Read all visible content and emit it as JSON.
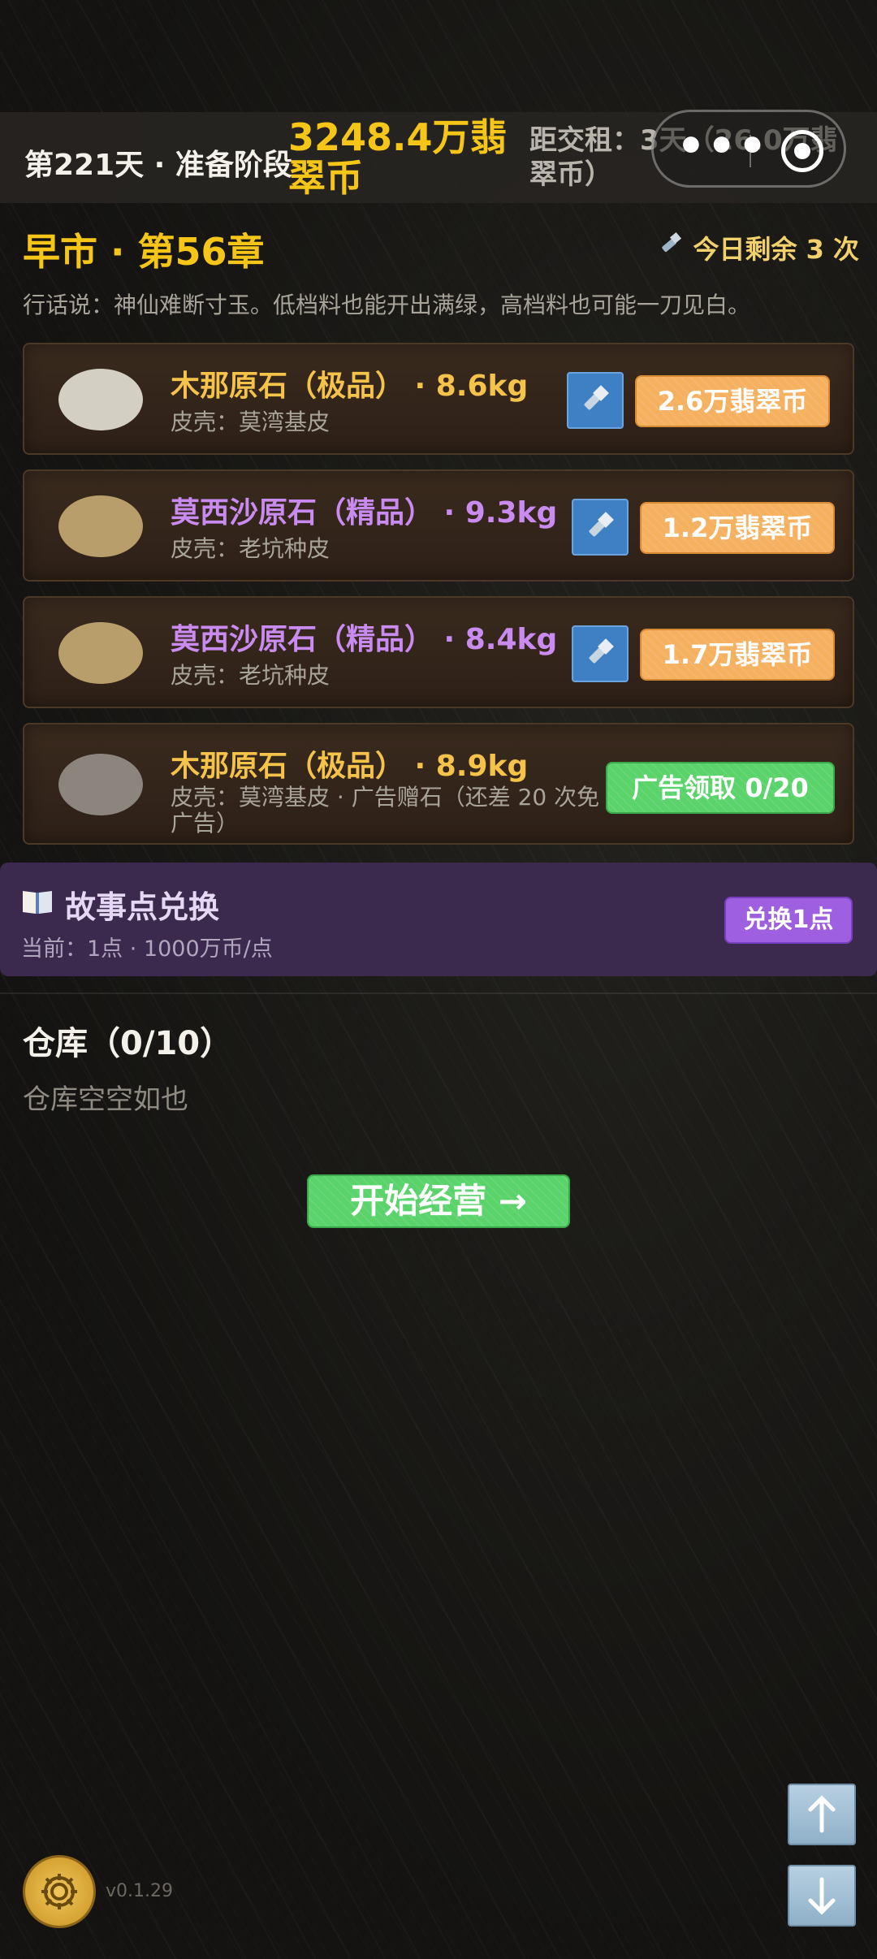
{
  "topbar": {
    "day_stage": "第221天 · 准备阶段",
    "money": "3248.4万翡翠币",
    "rent": "距交租：3天（26.0万翡翠币）"
  },
  "market": {
    "title": "早市 · 第56章",
    "remaining": "今日剩余 3 次",
    "saying": "行话说：神仙难断寸玉。低档料也能开出满绿，高档料也可能一刀见白。"
  },
  "stones": [
    {
      "name": "木那原石（极品） · 8.6kg",
      "skin": "皮壳：莫湾基皮",
      "price": "2.6万翡翠币",
      "color": "#f5c34a",
      "stone_color": "#d4cfc3"
    },
    {
      "name": "莫西沙原石（精品） · 9.3kg",
      "skin": "皮壳：老坑种皮",
      "price": "1.2万翡翠币",
      "color": "#c98bf0",
      "stone_color": "#b89e6a"
    },
    {
      "name": "莫西沙原石（精品） · 8.4kg",
      "skin": "皮壳：老坑种皮",
      "price": "1.7万翡翠币",
      "color": "#c98bf0",
      "stone_color": "#b89e6a"
    },
    {
      "name": "木那原石（极品） · 8.9kg",
      "skin": "皮壳：莫湾基皮 · 广告赠石（还差 20 次免广告）",
      "ad_label": "广告领取 0/20",
      "color": "#f5c34a",
      "stone_color": "#8c857e"
    }
  ],
  "story": {
    "title": "故事点兑换",
    "sub": "当前：1点 · 1000万币/点",
    "button": "兑换1点"
  },
  "warehouse": {
    "title": "仓库（0/10）",
    "empty": "仓库空空如也"
  },
  "start_button": "开始经营 →",
  "version": "v0.1.29"
}
